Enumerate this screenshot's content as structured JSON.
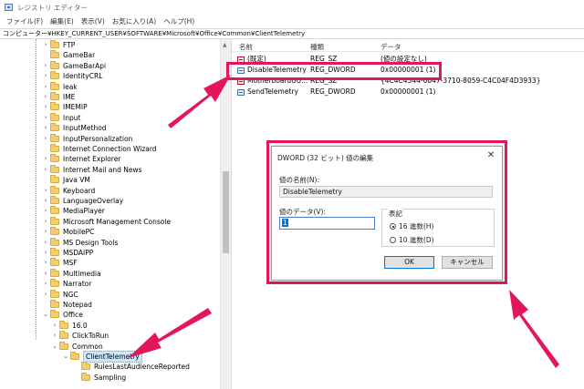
{
  "window": {
    "title": "レジストリ エディター"
  },
  "menu": [
    "ファイル(F)",
    "編集(E)",
    "表示(V)",
    "お気に入り(A)",
    "ヘルプ(H)"
  ],
  "address": "コンピューター¥HKEY_CURRENT_USER¥SOFTWARE¥Microsoft¥Office¥Common¥ClientTelemetry",
  "tree": {
    "items": [
      {
        "label": "FTP",
        "exp": "›"
      },
      {
        "label": "GameBar",
        "exp": ""
      },
      {
        "label": "GameBarApi",
        "exp": "›"
      },
      {
        "label": "IdentityCRL",
        "exp": "›"
      },
      {
        "label": "leak",
        "exp": "›"
      },
      {
        "label": "IME",
        "exp": "›"
      },
      {
        "label": "IMEMIP",
        "exp": "›"
      },
      {
        "label": "Input",
        "exp": "›"
      },
      {
        "label": "InputMethod",
        "exp": "›"
      },
      {
        "label": "InputPersonalization",
        "exp": "›"
      },
      {
        "label": "Internet Connection Wizard",
        "exp": ""
      },
      {
        "label": "Internet Explorer",
        "exp": "›"
      },
      {
        "label": "Internet Mail and News",
        "exp": "›"
      },
      {
        "label": "Java VM",
        "exp": ""
      },
      {
        "label": "Keyboard",
        "exp": "›"
      },
      {
        "label": "LanguageOverlay",
        "exp": "›"
      },
      {
        "label": "MediaPlayer",
        "exp": "›"
      },
      {
        "label": "Microsoft Management Console",
        "exp": "›"
      },
      {
        "label": "MobilePC",
        "exp": "›"
      },
      {
        "label": "MS Design Tools",
        "exp": "›"
      },
      {
        "label": "MSDAIPP",
        "exp": "›"
      },
      {
        "label": "MSF",
        "exp": "›"
      },
      {
        "label": "Multimedia",
        "exp": "›"
      },
      {
        "label": "Narrator",
        "exp": "›"
      },
      {
        "label": "NGC",
        "exp": "›"
      },
      {
        "label": "Notepad",
        "exp": ""
      },
      {
        "label": "Office",
        "exp": "⌄"
      },
      {
        "label": "16.0",
        "exp": "›"
      },
      {
        "label": "ClickToRun",
        "exp": "›"
      },
      {
        "label": "Common",
        "exp": "⌄"
      },
      {
        "label": "ClientTelemetry",
        "exp": "⌄"
      },
      {
        "label": "RulesLastAudienceReported",
        "exp": ""
      },
      {
        "label": "Sampling",
        "exp": ""
      }
    ]
  },
  "list": {
    "headers": {
      "name": "名前",
      "type": "種類",
      "data": "データ"
    },
    "rows": [
      {
        "name": "(既定)",
        "type": "REG_SZ",
        "data": "(値の設定なし)",
        "kind": "sz"
      },
      {
        "name": "DisableTelemetry",
        "type": "REG_DWORD",
        "data": "0x00000001 (1)",
        "kind": "dw"
      },
      {
        "name": "MotherboardUU...",
        "type": "REG_SZ",
        "data": "{4C4C4544-0047-3710-8059-C4C04F4D3933}",
        "kind": "sz"
      },
      {
        "name": "SendTelemetry",
        "type": "REG_DWORD",
        "data": "0x00000001 (1)",
        "kind": "dw"
      }
    ]
  },
  "dialog": {
    "title": "DWORD (32 ビット) 値の編集",
    "close": "✕",
    "name_label": "値の名前(N):",
    "name_value": "DisableTelemetry",
    "data_label": "値のデータ(V):",
    "data_value": "1",
    "base_label": "表記",
    "hex_label": "16 進数(H)",
    "dec_label": "10 進数(D)",
    "ok": "OK",
    "cancel": "キャンセル"
  },
  "accent_color": "#e3165b"
}
